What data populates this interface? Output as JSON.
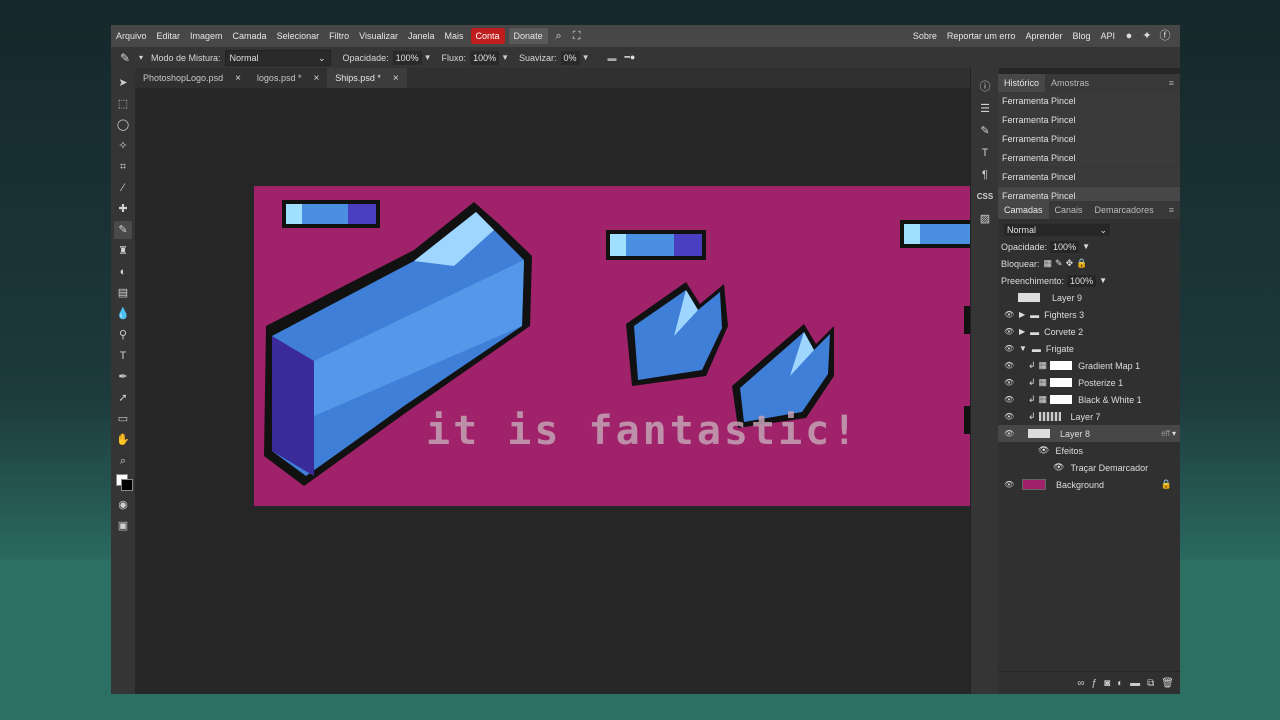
{
  "menu": {
    "items": [
      "Arquivo",
      "Editar",
      "Imagem",
      "Camada",
      "Selecionar",
      "Filtro",
      "Visualizar",
      "Janela",
      "Mais"
    ],
    "conta": "Conta",
    "donate": "Donate",
    "right_items": [
      "Sobre",
      "Reportar um erro",
      "Aprender",
      "Blog",
      "API"
    ],
    "icons": [
      "search-icon",
      "fullscreen-icon",
      "reddit-icon",
      "twitter-icon",
      "facebook-icon"
    ]
  },
  "options": {
    "blend_label": "Modo de Mistura:",
    "blend_value": "Normal",
    "opacity_label": "Opacidade:",
    "opacity_value": "100%",
    "flow_label": "Fluxo:",
    "flow_value": "100%",
    "smooth_label": "Suavizar:",
    "smooth_value": "0%"
  },
  "tabs": [
    {
      "label": "PhotoshopLogo.psd",
      "close": "×"
    },
    {
      "label": "logos.psd *",
      "close": "×"
    },
    {
      "label": "Ships.psd *",
      "close": "×"
    }
  ],
  "canvas": {
    "text": "it is fantastic!",
    "background_color": "#a0226a"
  },
  "history": {
    "tabs": [
      "Histórico",
      "Amostras"
    ],
    "items": [
      "Ferramenta Pincel",
      "Ferramenta Pincel",
      "Ferramenta Pincel",
      "Ferramenta Pincel",
      "Ferramenta Pincel",
      "Ferramenta Pincel"
    ]
  },
  "layers": {
    "tabs": [
      "Camadas",
      "Canais",
      "Demarcadores"
    ],
    "blend_mode": "Normal",
    "opacity_label": "Opacidade:",
    "opacity_value": "100%",
    "lock_label": "Bloquear:",
    "fill_label": "Preenchimento:",
    "fill_value": "100%",
    "items": [
      {
        "name": "Layer 9"
      },
      {
        "name": "Fighters 3"
      },
      {
        "name": "Corvete 2"
      },
      {
        "name": "Frigate"
      },
      {
        "name": "Gradient Map 1"
      },
      {
        "name": "Posterize 1"
      },
      {
        "name": "Black & White 1"
      },
      {
        "name": "Layer 7"
      },
      {
        "name": "Layer 8",
        "fx": "eff"
      },
      {
        "name": "Efeitos"
      },
      {
        "name": "Traçar Demarcador"
      },
      {
        "name": "Background"
      }
    ]
  },
  "colors": {
    "accent_red": "#c01e1e",
    "canvas_magenta": "#a0226a",
    "ship_blue": "#3f7fd8"
  }
}
